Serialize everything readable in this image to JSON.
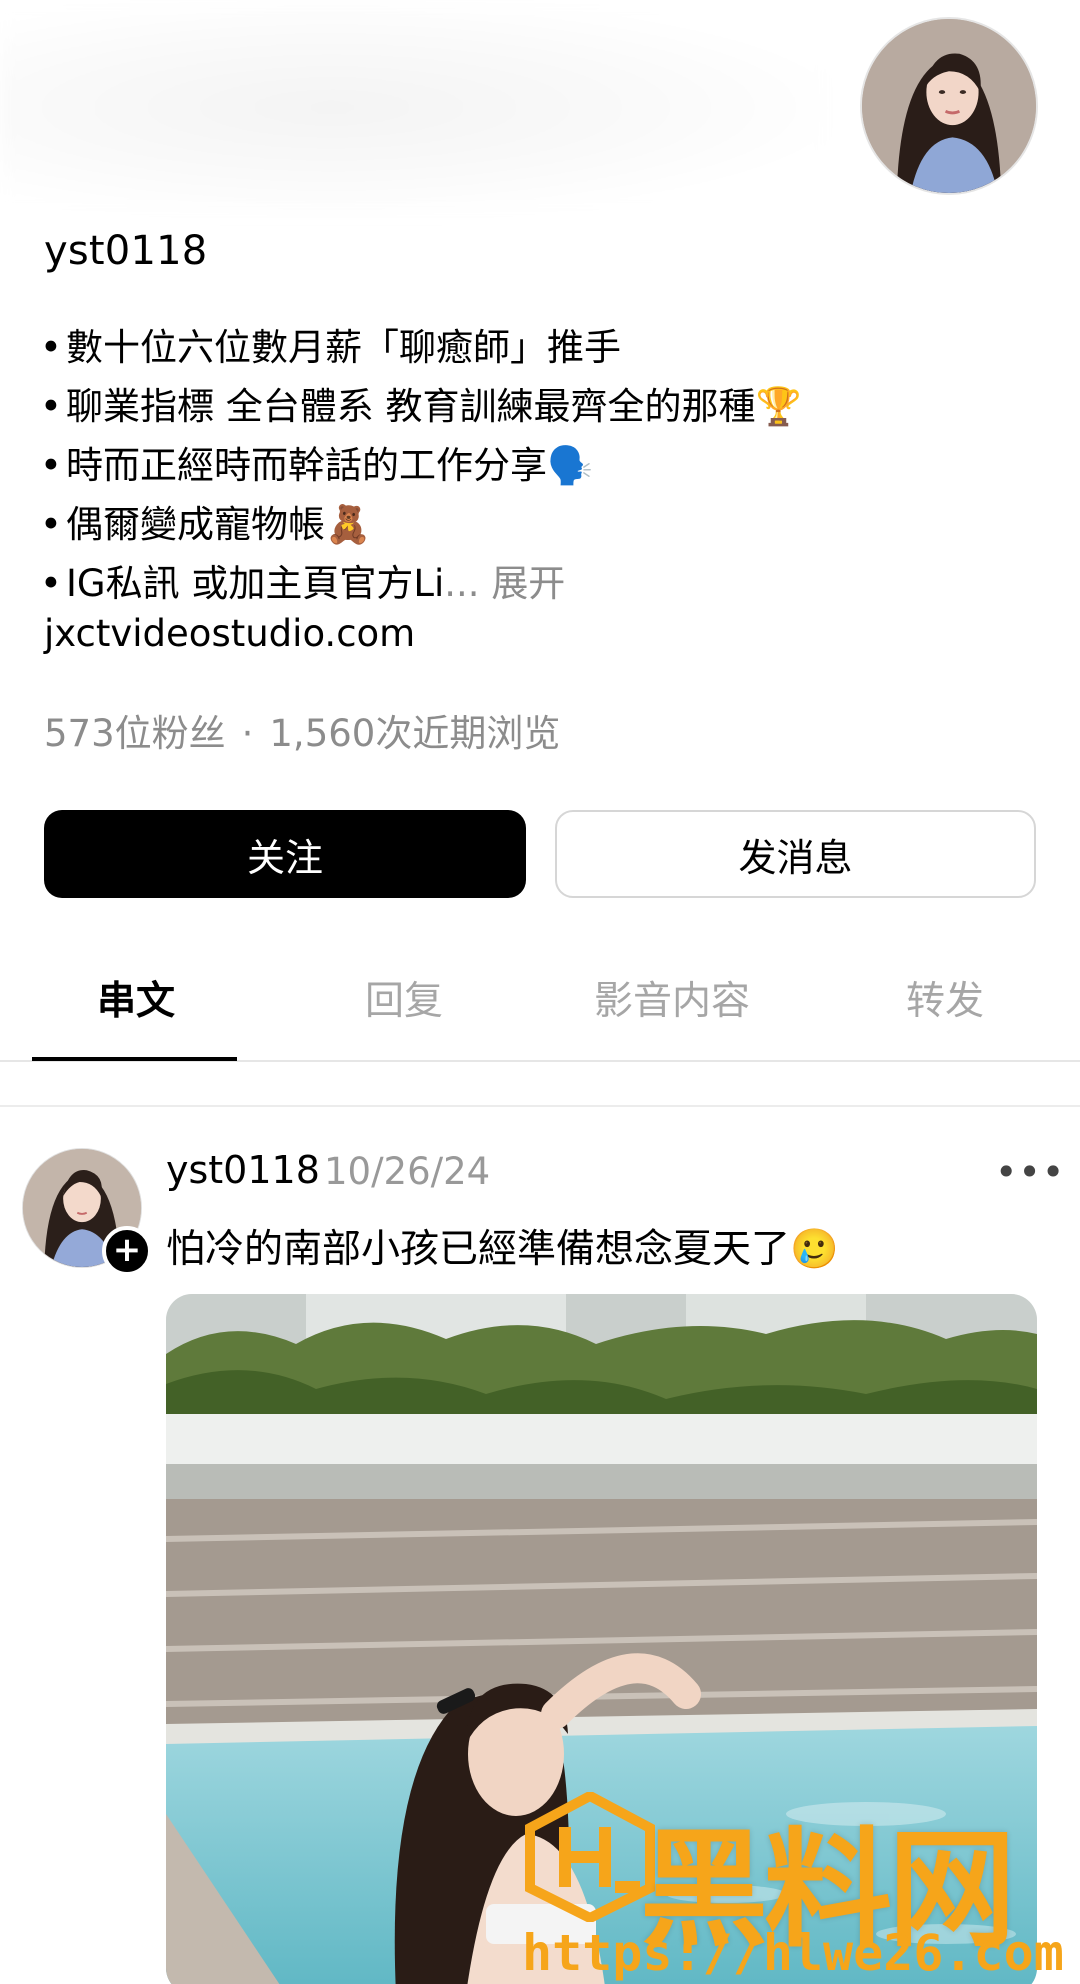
{
  "profile": {
    "username": "yst0118",
    "bio_lines": [
      "數十位六位數月薪「聊癒師」推手",
      "聊業指標 全台體系 教育訓練最齊全的那種🏆",
      "時而正經時而幹話的工作分享🗣️",
      "偶爾變成寵物帳🧸",
      "IG私訊 或加主頁官方Li"
    ],
    "bio_ellipsis": "...",
    "bio_more_label": "展开",
    "website": "jxctvideostudio.com",
    "followers": "573位粉丝",
    "separator": "·",
    "views": "1,560次近期浏览",
    "avatar_icon": "profile-photo"
  },
  "actions": {
    "follow_label": "关注",
    "message_label": "发消息"
  },
  "tabs": [
    {
      "label": "串文",
      "active": true
    },
    {
      "label": "回复",
      "active": false
    },
    {
      "label": "影音内容",
      "active": false
    },
    {
      "label": "转发",
      "active": false
    }
  ],
  "post": {
    "author": "yst0118",
    "date": "10/26/24",
    "text": "怕冷的南部小孩已經準備想念夏天了🥲",
    "more_icon": "ellipsis-icon",
    "follow_icon": "plus-icon"
  },
  "watermark": {
    "title": "黑料网",
    "url": "https://hlwe26.com"
  },
  "colors": {
    "follow_bg": "#000000",
    "secondary_text": "#8c8c8c",
    "watermark": "#f6a51a"
  }
}
